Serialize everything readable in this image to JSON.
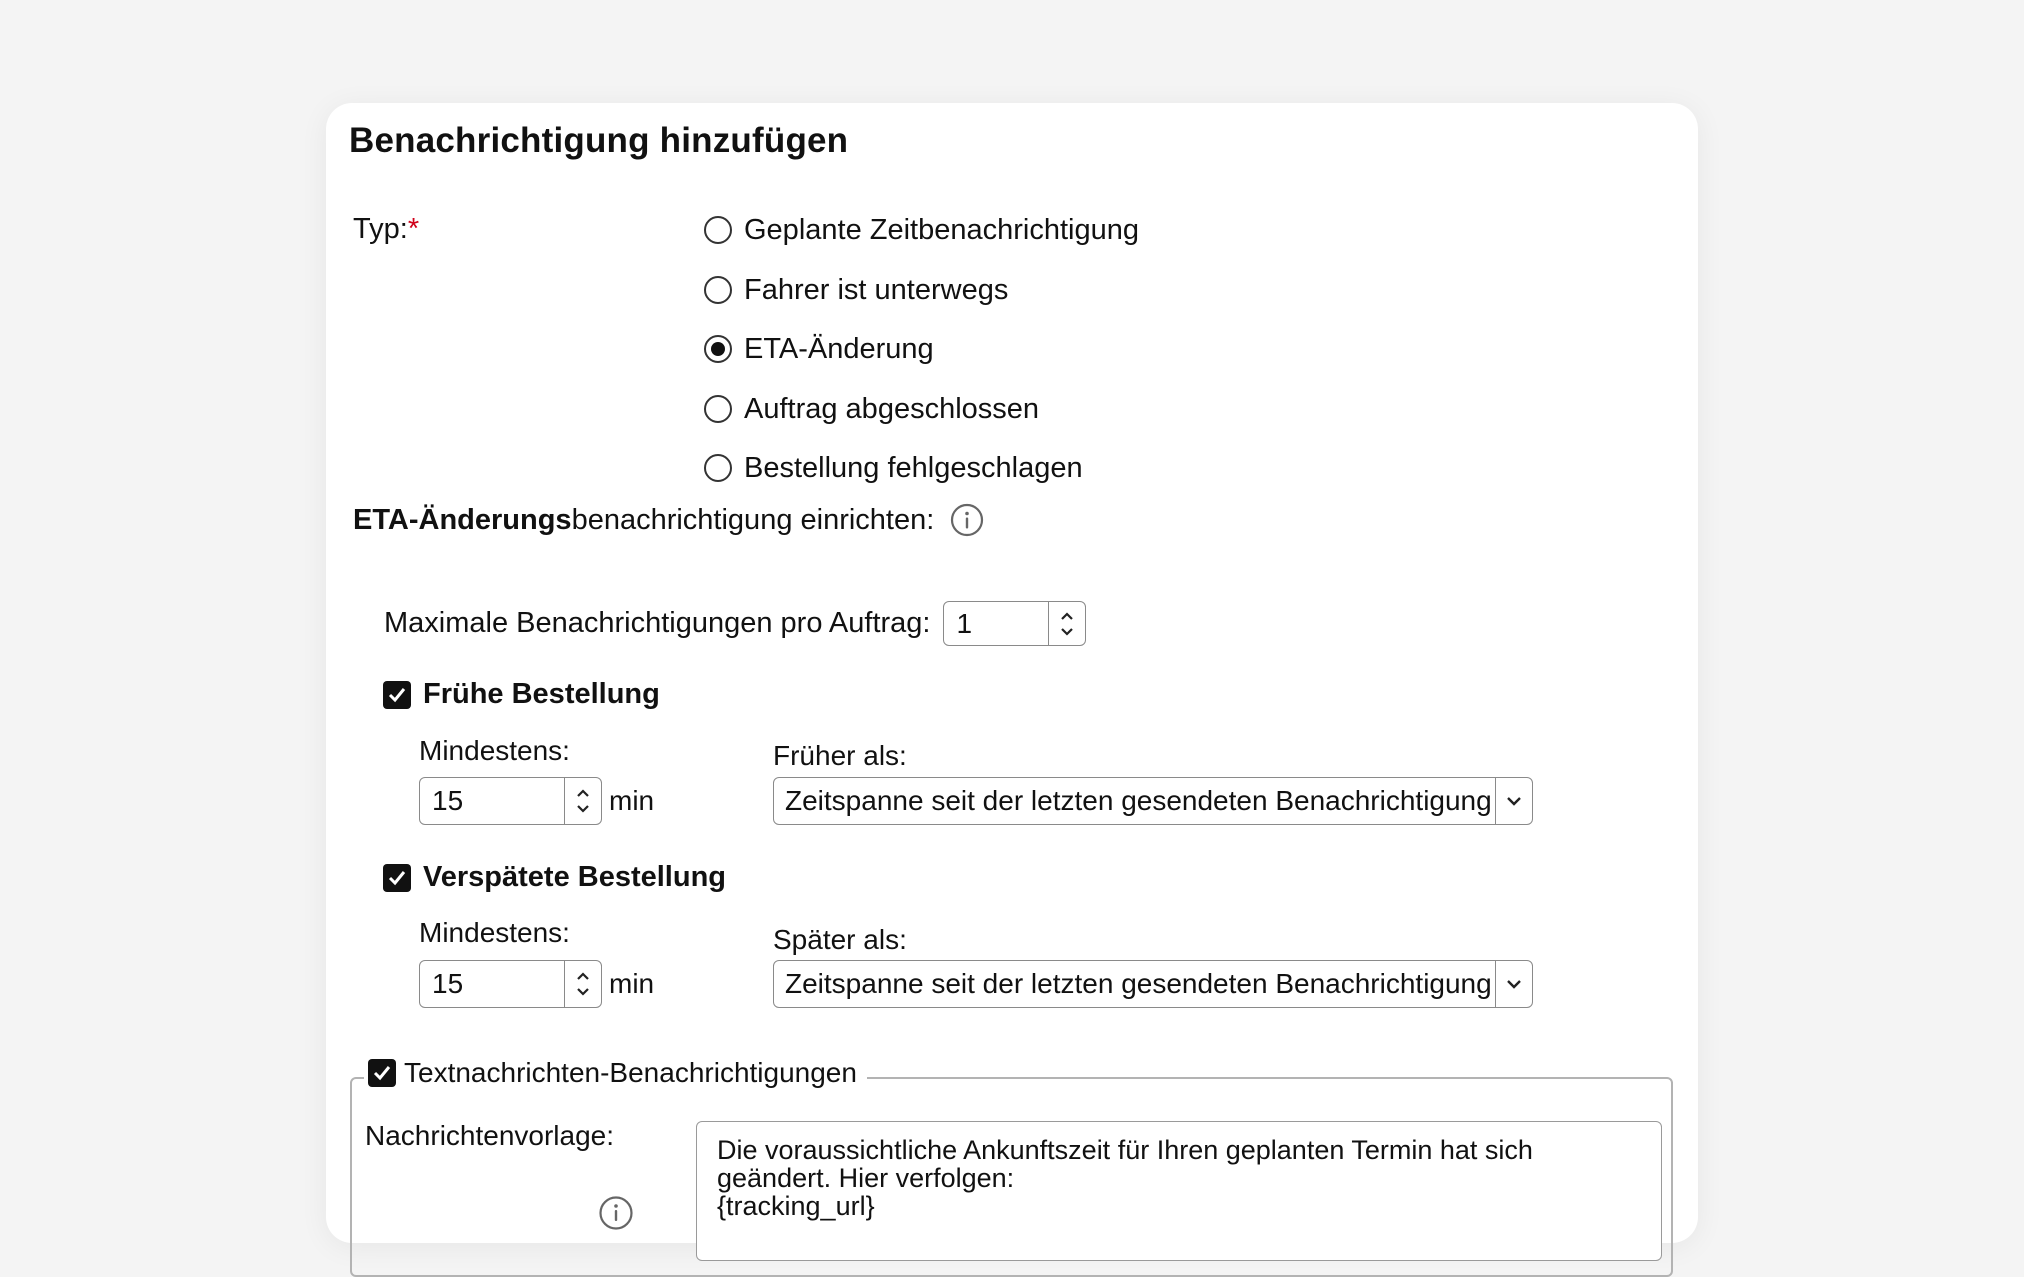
{
  "dialog": {
    "title": "Benachrichtigung hinzufügen"
  },
  "type_field": {
    "label": "Typ:",
    "required_marker": "*",
    "options": [
      {
        "label": "Geplante Zeitbenachrichtigung",
        "checked": false
      },
      {
        "label": "Fahrer ist unterwegs",
        "checked": false
      },
      {
        "label": "ETA-Änderung",
        "checked": true
      },
      {
        "label": "Auftrag abgeschlossen",
        "checked": false
      },
      {
        "label": "Bestellung fehlgeschlagen",
        "checked": false
      }
    ]
  },
  "eta_section": {
    "heading_bold": "ETA-Änderungs",
    "heading_rest": "benachrichtigung einrichten:",
    "info_icon": "info-icon",
    "max_label": "Maximale Benachrichtigungen pro Auftrag:",
    "max_value": "1",
    "early": {
      "checked": true,
      "label": "Frühe Bestellung",
      "min_label": "Mindestens:",
      "min_value": "15",
      "unit": "min",
      "compare_label": "Früher als:",
      "compare_value": "Zeitspanne seit der letzten gesendeten Benachrichtigung"
    },
    "late": {
      "checked": true,
      "label": "Verspätete Bestellung",
      "min_label": "Mindestens:",
      "min_value": "15",
      "unit": "min",
      "compare_label": "Später als:",
      "compare_value": "Zeitspanne seit der letzten gesendeten Benachrichtigung"
    }
  },
  "sms_section": {
    "checked": true,
    "legend": "Textnachrichten-Benachrichtigungen",
    "template_label": "Nachrichtenvorlage:",
    "template_text": "Die voraussichtliche Ankunftszeit für Ihren geplanten Termin hat sich\ngeändert. Hier verfolgen:\n{tracking_url}"
  }
}
